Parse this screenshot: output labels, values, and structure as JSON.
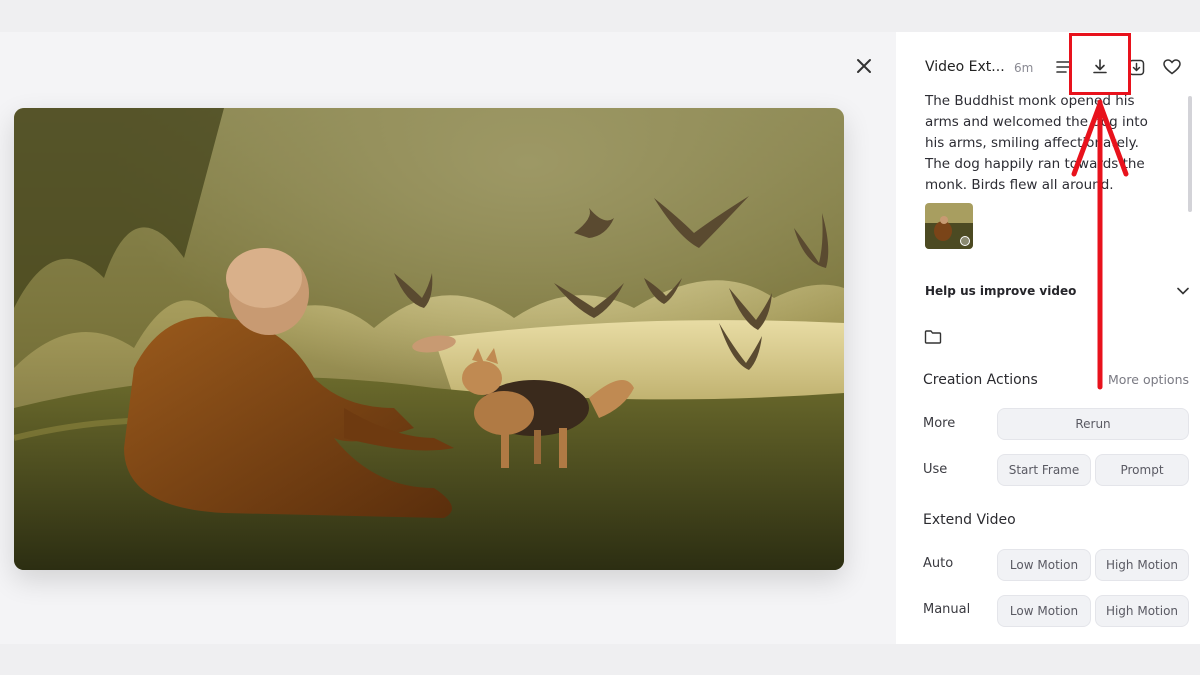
{
  "viewer": {
    "close_icon": "close-icon"
  },
  "panel": {
    "title": "Video Ext...",
    "age": "6m",
    "header_icons": [
      "list-icon",
      "download-icon",
      "save-icon",
      "heart-icon"
    ],
    "prompt": "The Buddhist monk opened his arms and welcomed the dog into his arms, smiling affectionately. The dog happily ran towards the monk. Birds flew all around.",
    "help_label": "Help us improve video",
    "creation_actions": {
      "title": "Creation Actions",
      "more_options": "More options",
      "more_label": "More",
      "rerun": "Rerun",
      "use_label": "Use",
      "start_frame": "Start Frame",
      "prompt_btn": "Prompt"
    },
    "extend_video": {
      "title": "Extend Video",
      "auto_label": "Auto",
      "manual_label": "Manual",
      "low_motion": "Low Motion",
      "high_motion": "High Motion"
    }
  },
  "colors": {
    "highlight": "#e8121c",
    "button_bg": "#f1f2f5",
    "panel_bg": "#ffffff"
  }
}
